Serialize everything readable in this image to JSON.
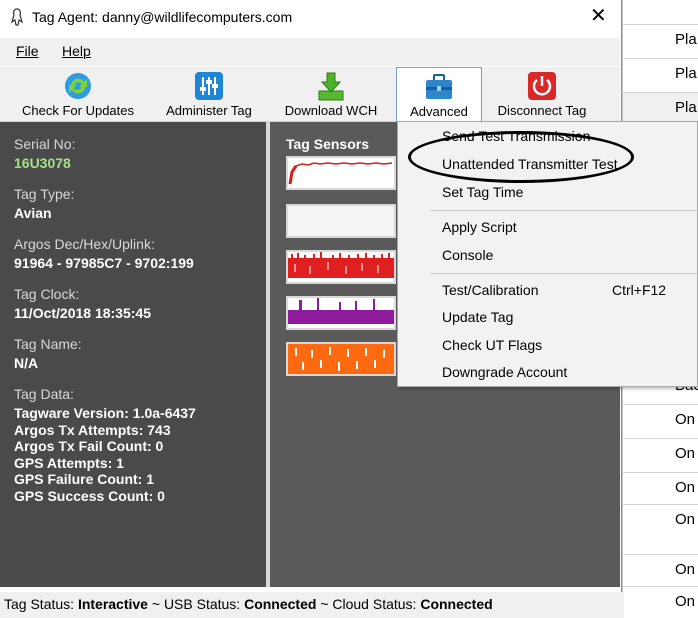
{
  "window": {
    "title": "Tag Agent: danny@wildlifecomputers.com",
    "close": "✕"
  },
  "menubar": {
    "file": "File",
    "help": "Help"
  },
  "toolbar": {
    "buttons": [
      {
        "label": "Check For Updates",
        "icon": "refresh-icon"
      },
      {
        "label": "Administer Tag",
        "icon": "sliders-icon"
      },
      {
        "label": "Download WCH",
        "icon": "download-icon"
      },
      {
        "label": "Advanced",
        "icon": "toolbox-icon"
      },
      {
        "label": "Disconnect Tag",
        "icon": "power-icon"
      }
    ]
  },
  "tag_info": {
    "serial_label": "Serial No:",
    "serial_value": "16U3078",
    "type_label": "Tag Type:",
    "type_value": "Avian",
    "argos_label": "Argos Dec/Hex/Uplink:",
    "argos_value": "91964 - 97985C7 - 9702:199",
    "clock_label": "Tag Clock:",
    "clock_value": "11/Oct/2018 18:35:45",
    "name_label": "Tag Name:",
    "name_value": "N/A",
    "data_label": "Tag Data:",
    "data_lines": [
      "Tagware Version: 1.0a-6437",
      "Argos Tx Attempts: 743",
      "Argos Tx Fail Count: 0",
      "GPS Attempts: 1",
      "GPS Failure Count: 1",
      "GPS Success Count: 0"
    ]
  },
  "sensors": {
    "title": "Tag Sensors"
  },
  "advanced_menu": {
    "items": [
      {
        "label": "Send Test Transmission"
      },
      {
        "label": "Unattended Transmitter Test"
      },
      {
        "label": "Set Tag Time"
      },
      {
        "label": "Apply Script"
      },
      {
        "label": "Console"
      },
      {
        "label": "Test/Calibration",
        "shortcut": "Ctrl+F12"
      },
      {
        "label": "Update Tag"
      },
      {
        "label": "Check UT Flags"
      },
      {
        "label": "Downgrade Account"
      }
    ]
  },
  "status": {
    "tag_label": "Tag Status:",
    "tag_value": "Interactive",
    "usb_label": "~ USB Status:",
    "usb_value": "Connected",
    "cloud_label": "~ Cloud Status:",
    "cloud_value": "Connected"
  },
  "background_sheet": {
    "rows": [
      "Pla",
      "Pla",
      "Pla",
      "Bac",
      "On",
      "On",
      "On",
      "On",
      "On",
      "On"
    ]
  },
  "colors": {
    "serial_green": "#a7e08a",
    "panel_dark": "#4a4a4a",
    "sensor_red": "#e02020",
    "sensor_purple": "#8e1a9e",
    "sensor_orange": "#ff6a10"
  }
}
